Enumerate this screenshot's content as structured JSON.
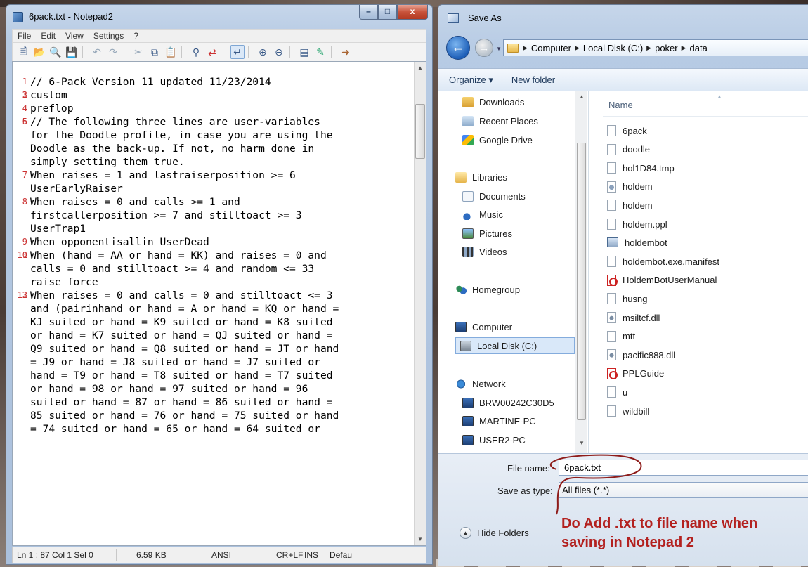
{
  "notepad": {
    "title": "6pack.txt - Notepad2",
    "caption": {
      "minimize": "–",
      "maximize": "□",
      "close": "x"
    },
    "menu": [
      "File",
      "Edit",
      "View",
      "Settings",
      "?"
    ],
    "toolbar_icons": [
      "new-icon",
      "open-icon",
      "find-file-icon",
      "save-icon",
      "undo-icon",
      "redo-icon",
      "cut-icon",
      "copy-icon",
      "paste-icon",
      "find-icon",
      "replace-icon",
      "word-wrap-icon",
      "zoom-in-icon",
      "zoom-out-icon",
      "scheme-icon",
      "customize-icon",
      "exit-icon"
    ],
    "lines": [
      {
        "n": "1",
        "text": "// 6-Pack Version 11 updated 11/23/2014"
      },
      {
        "n": "2",
        "text": ""
      },
      {
        "n": "3",
        "text": "custom"
      },
      {
        "n": "4",
        "text": "preflop"
      },
      {
        "n": "5",
        "text": ""
      },
      {
        "n": "6",
        "text": "// The following three lines are user-variables"
      },
      {
        "n": "",
        "text": "for the Doodle profile, in case you are using the"
      },
      {
        "n": "",
        "text": "Doodle as the back-up. If not, no harm done in"
      },
      {
        "n": "",
        "text": "simply setting them true."
      },
      {
        "n": "7",
        "text": "When raises = 1 and lastraiserposition >= 6"
      },
      {
        "n": "",
        "text": "UserEarlyRaiser"
      },
      {
        "n": "8",
        "text": "When raises = 0 and calls >= 1 and"
      },
      {
        "n": "",
        "text": "firstcallerposition >= 7 and stilltoact >= 3"
      },
      {
        "n": "",
        "text": "UserTrap1"
      },
      {
        "n": "9",
        "text": "When opponentisallin UserDead"
      },
      {
        "n": "10",
        "text": ""
      },
      {
        "n": "11",
        "text": "When (hand = AA or hand = KK) and raises = 0 and"
      },
      {
        "n": "",
        "text": "calls = 0 and stilltoact >= 4 and random <= 33"
      },
      {
        "n": "",
        "text": "raise force"
      },
      {
        "n": "12",
        "text": ""
      },
      {
        "n": "13",
        "text": "When raises = 0 and calls = 0 and stilltoact <= 3"
      },
      {
        "n": "",
        "text": "and (pairinhand or hand = A or hand = KQ or hand ="
      },
      {
        "n": "",
        "text": "KJ suited or hand = K9 suited or hand = K8 suited"
      },
      {
        "n": "",
        "text": "or hand = K7 suited or hand = QJ suited or hand ="
      },
      {
        "n": "",
        "text": "Q9 suited or hand = Q8 suited or hand = JT or hand"
      },
      {
        "n": "",
        "text": "= J9 or hand = J8 suited or hand = J7 suited or"
      },
      {
        "n": "",
        "text": "hand = T9 or hand = T8 suited or hand = T7 suited"
      },
      {
        "n": "",
        "text": "or hand = 98 or hand = 97 suited or hand = 96"
      },
      {
        "n": "",
        "text": "suited or hand = 87 or hand = 86 suited or hand ="
      },
      {
        "n": "",
        "text": "85 suited or hand = 76 or hand = 75 suited or hand"
      },
      {
        "n": "",
        "text": "= 74 suited or hand = 65 or hand = 64 suited or"
      }
    ],
    "status": {
      "position": "Ln 1 : 87  Col 1  Sel 0",
      "size": "6.59 KB",
      "encoding": "ANSI",
      "eol": "CR+LF",
      "mode": "INS",
      "scheme": "Defau"
    }
  },
  "save_as": {
    "title": "Save As",
    "breadcrumb": [
      "Computer",
      "Local Disk (C:)",
      "poker",
      "data"
    ],
    "commands": {
      "organize": "Organize ▾",
      "new_folder": "New folder"
    },
    "nav": {
      "favorites": [
        "Downloads",
        "Recent Places",
        "Google Drive"
      ],
      "libraries_header": "Libraries",
      "libraries": [
        "Documents",
        "Music",
        "Pictures",
        "Videos"
      ],
      "homegroup": "Homegroup",
      "computer_header": "Computer",
      "local_disk": "Local Disk (C:)",
      "network_header": "Network",
      "network": [
        "BRW00242C30D5",
        "MARTINE-PC",
        "USER2-PC"
      ]
    },
    "column_name": "Name",
    "files": [
      {
        "name": "6pack",
        "type": "file"
      },
      {
        "name": "doodle",
        "type": "file"
      },
      {
        "name": "hol1D84.tmp",
        "type": "file"
      },
      {
        "name": "holdem",
        "type": "gear"
      },
      {
        "name": "holdem",
        "type": "file"
      },
      {
        "name": "holdem.ppl",
        "type": "file"
      },
      {
        "name": "holdembot",
        "type": "exe"
      },
      {
        "name": "holdembot.exe.manifest",
        "type": "file"
      },
      {
        "name": "HoldemBotUserManual",
        "type": "pdf"
      },
      {
        "name": "husng",
        "type": "file"
      },
      {
        "name": "msiltcf.dll",
        "type": "dll"
      },
      {
        "name": "mtt",
        "type": "file"
      },
      {
        "name": "pacific888.dll",
        "type": "dll"
      },
      {
        "name": "PPLGuide",
        "type": "pdf"
      },
      {
        "name": "u",
        "type": "file"
      },
      {
        "name": "wildbill",
        "type": "file"
      }
    ],
    "file_name_label": "File name:",
    "file_name_value": "6pack.txt",
    "save_type_label": "Save as type:",
    "save_type_value": "All files (*.*)",
    "hide_folders": "Hide Folders",
    "annotation_line1": "Do Add .txt to file name when",
    "annotation_line2": "saving in Notepad 2",
    "annotation_color": "#b3211f"
  }
}
